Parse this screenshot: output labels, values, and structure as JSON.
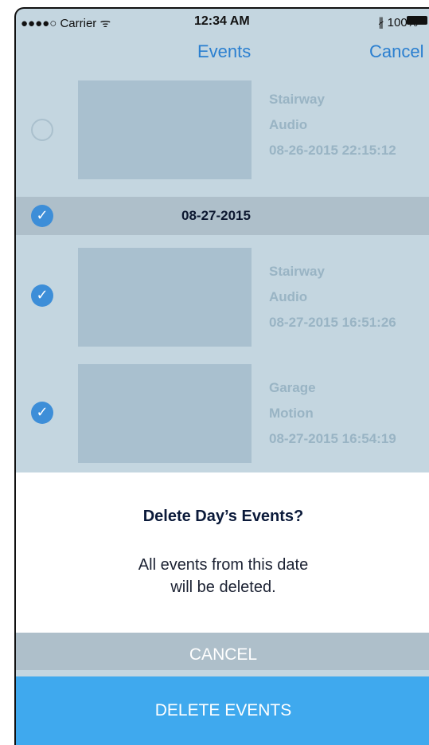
{
  "status_bar": {
    "carrier": "●●●●○ Carrier ᯤ",
    "time": "12:34 AM",
    "battery_text": "∦ 100%"
  },
  "nav": {
    "title": "Events",
    "cancel_label": "Cancel"
  },
  "events_before": [
    {
      "location": "Stairway",
      "type": "Audio",
      "timestamp": "08-26-2015 22:15:12",
      "selected": false
    }
  ],
  "date_header": {
    "date": "08-27-2015",
    "selected": true
  },
  "events": [
    {
      "location": "Stairway",
      "type": "Audio",
      "timestamp": "08-27-2015 16:51:26",
      "selected": true
    },
    {
      "location": "Garage",
      "type": "Motion",
      "timestamp": "08-27-2015 16:54:19",
      "selected": true
    }
  ],
  "dialog": {
    "title": "Delete Day’s Events?",
    "message_line1": "All events from this date",
    "message_line2": "will be deleted.",
    "cancel_label": "CANCEL",
    "delete_label": "DELETE EVENTS"
  },
  "colors": {
    "accent": "#3fa9ee",
    "nav_tint": "#2a7fd0",
    "overlay": "#c4d6e0"
  }
}
